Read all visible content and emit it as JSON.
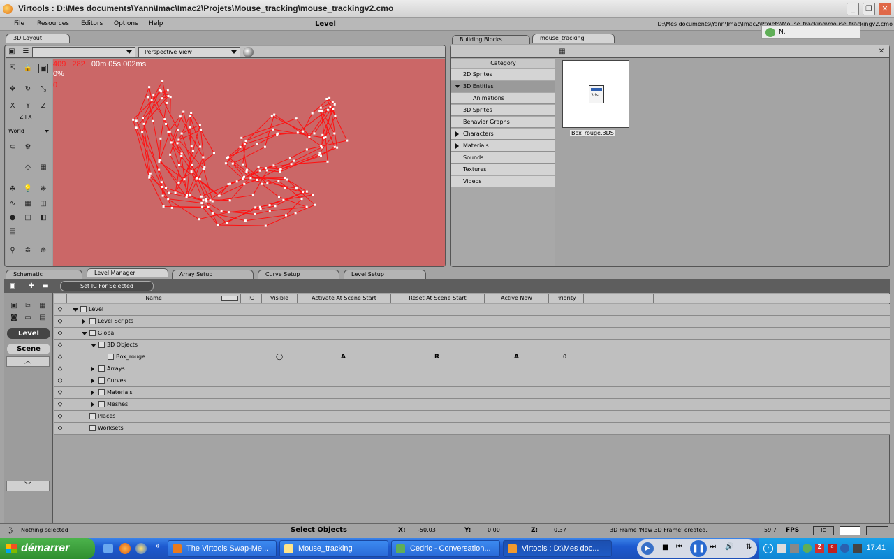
{
  "window": {
    "title": "Virtools : D:\\Mes documents\\Yann\\Imac\\Imac2\\Projets\\Mouse_tracking\\mouse_trackingv2.cmo",
    "level_title": "Level",
    "path": "D:\\Mes documents\\Yann\\Imac\\Imac2\\Projets\\Mouse_tracking\\mouse_trackingv2.cmo"
  },
  "menu": [
    "File",
    "Resources",
    "Editors",
    "Options",
    "Help"
  ],
  "notification": {
    "text": "N."
  },
  "layout": {
    "tab": "3D Layout",
    "view_select": "Perspective View",
    "coord_x": "409",
    "coord_y": "282",
    "time": "00m 05s 002ms",
    "percent": "0%",
    "counter": "0",
    "space": "World",
    "axis_label": "Z+X"
  },
  "bb": {
    "tabs": [
      "Building Blocks",
      "mouse_tracking"
    ],
    "category_header": "Category",
    "categories": [
      {
        "label": "2D Sprites",
        "expander": "none"
      },
      {
        "label": "3D Entities",
        "expander": "open",
        "selected": true
      },
      {
        "label": "Animations",
        "expander": "none",
        "sub": true
      },
      {
        "label": "3D Sprites",
        "expander": "none"
      },
      {
        "label": "Behavior Graphs",
        "expander": "none"
      },
      {
        "label": "Characters",
        "expander": "closed"
      },
      {
        "label": "Materials",
        "expander": "closed"
      },
      {
        "label": "Sounds",
        "expander": "none"
      },
      {
        "label": "Textures",
        "expander": "none"
      },
      {
        "label": "Videos",
        "expander": "none"
      }
    ],
    "file_label": "Box_rouge.3DS",
    "file_icon_text": "3ds"
  },
  "lower_tabs": [
    "Schematic",
    "Level Manager",
    "Array Setup",
    "Curve Setup",
    "Level Setup"
  ],
  "level_manager": {
    "set_ic_button": "Set IC For Selected",
    "level_button": "Level",
    "scene_button": "Scene",
    "columns": [
      "Name",
      "IC",
      "Visible",
      "Activate At Scene Start",
      "Reset At Scene Start",
      "Active Now",
      "Priority"
    ],
    "rows": [
      {
        "name": "Level",
        "indent": 0,
        "expander": "open"
      },
      {
        "name": "Level Scripts",
        "indent": 1,
        "expander": "closed"
      },
      {
        "name": "Global",
        "indent": 1,
        "expander": "open"
      },
      {
        "name": "3D Objects",
        "indent": 2,
        "expander": "open"
      },
      {
        "name": "Box_rouge",
        "indent": 3,
        "expander": "none",
        "visible": "◯",
        "activate": "A",
        "reset": "R",
        "active_now": "A",
        "priority": "0"
      },
      {
        "name": "Arrays",
        "indent": 2,
        "expander": "closed"
      },
      {
        "name": "Curves",
        "indent": 2,
        "expander": "closed"
      },
      {
        "name": "Materials",
        "indent": 2,
        "expander": "closed"
      },
      {
        "name": "Meshes",
        "indent": 2,
        "expander": "closed"
      },
      {
        "name": "Places",
        "indent": 1,
        "expander": "none"
      },
      {
        "name": "Worksets",
        "indent": 1,
        "expander": "none"
      }
    ]
  },
  "status": {
    "selection": "Nothing selected",
    "mode": "Select Objects",
    "x_label": "X:",
    "x": "-50.03",
    "y_label": "Y:",
    "y": "0.00",
    "z_label": "Z:",
    "z": "0.37",
    "message": "3D Frame 'New 3D Frame' created.",
    "fps_value": "59.7",
    "fps_label": "FPS"
  },
  "taskbar": {
    "start": "démarrer",
    "tasks": [
      {
        "label": "The Virtools Swap-Me...",
        "color": "#e87a1e"
      },
      {
        "label": "Mouse_tracking",
        "color": "#ffe48a"
      },
      {
        "label": "Cedric - Conversation...",
        "color": "#5fae57"
      },
      {
        "label": "Virtools : D:\\Mes doc...",
        "color": "#f29a2e"
      }
    ],
    "clock": "17:41"
  },
  "colors": {
    "viewport": "#cb6767",
    "curve": "#ff1010",
    "points": "#ffffff"
  }
}
